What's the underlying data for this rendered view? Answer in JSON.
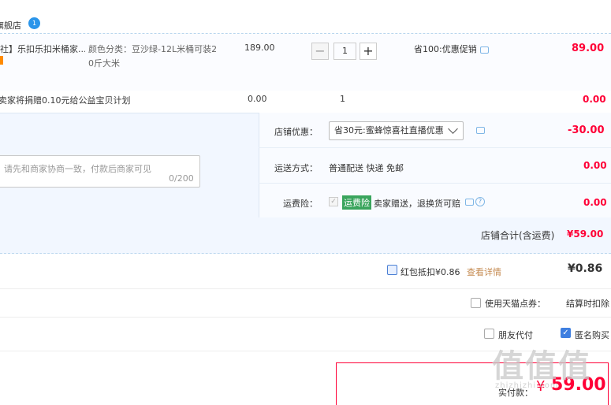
{
  "shop": {
    "name": "旗舰店",
    "badge": "1"
  },
  "item": {
    "title": "社】乐扣乐扣米桶家...",
    "sku_line1": "颜色分类：豆沙绿-12L米桶可装2",
    "sku_line2": "0斤大米",
    "price": "189.00",
    "quantity": "1",
    "qty_minus": "−",
    "qty_plus": "+",
    "promo": "省100:优惠促销",
    "total": "89.00"
  },
  "charity": {
    "text": "卖家将捐赠0.10元给公益宝贝计划",
    "price": "0.00",
    "quantity": "1",
    "total": "0.00"
  },
  "memo": {
    "placeholder": "请先和商家协商一致，付款后商家可见",
    "count": "0/200"
  },
  "options": {
    "coupon_label": "店铺优惠：",
    "coupon_value": "省30元:蜜蜂惊喜社直播优惠",
    "coupon_amount": "-30.00",
    "ship_label": "运送方式：",
    "ship_value": "普通配送 快递 免邮",
    "ship_amount": "0.00",
    "ins_label": "运费险：",
    "ins_badge": "运费险",
    "ins_text": "卖家赠送，退换货可赔",
    "ins_amount": "0.00",
    "ins_help": "?",
    "ins_check": "✓"
  },
  "shop_total": {
    "label": "店铺合计(含运费)",
    "value": "¥59.00"
  },
  "red_packet": {
    "label": "红包抵扣¥0.86",
    "detail": "查看详情",
    "value": "¥0.86"
  },
  "tmall_points": {
    "label": "使用天猫点券：",
    "value": "结算时扣除"
  },
  "checkout": {
    "friend_pay_label": "朋友代付",
    "anonymous_label": "匿名购买",
    "anonymous_checked": "✓",
    "pay_label": "实付款：",
    "pay_currency": "¥",
    "pay_value": "59.00"
  },
  "watermark": {
    "main": "值值值",
    "sub": "zhizhizhi.com"
  },
  "colors": {
    "accent_red": "#ff0036",
    "panel_blue": "#f2f7ff",
    "link_orange": "#c4894f"
  },
  "icons": [
    "shop-badge-icon",
    "chat-icon",
    "help-icon",
    "chevron-down-icon"
  ]
}
